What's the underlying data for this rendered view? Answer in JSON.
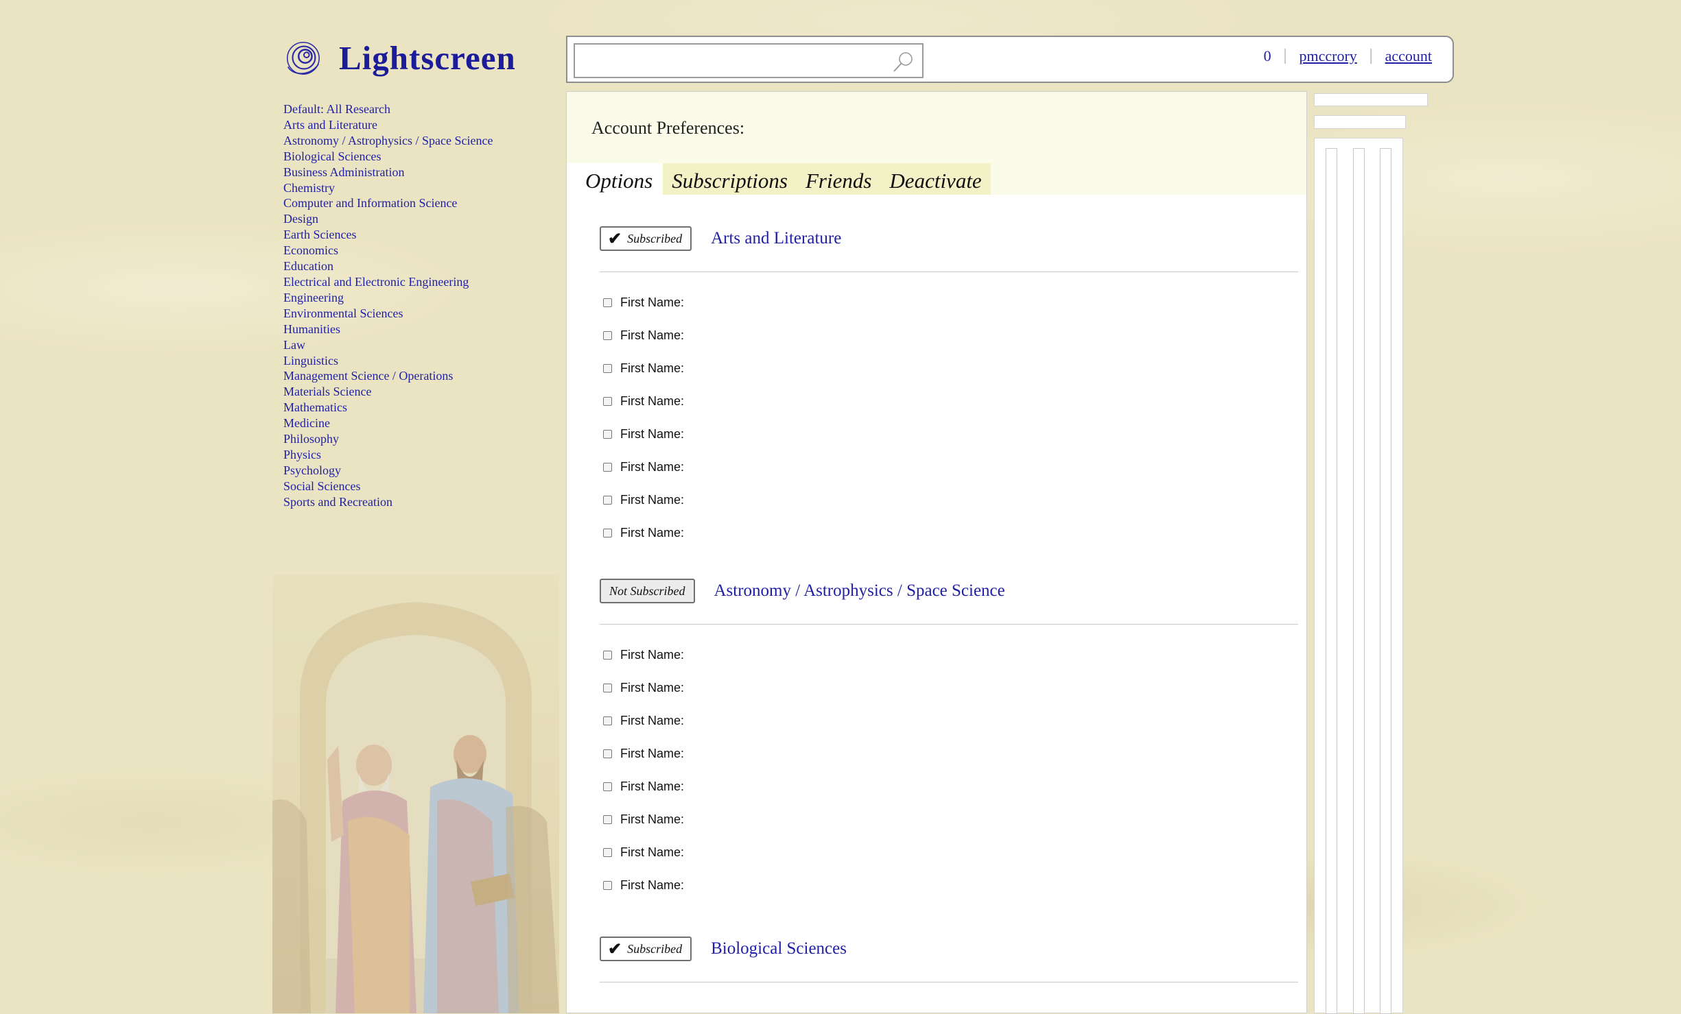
{
  "app": {
    "name": "Lightscreen"
  },
  "search": {
    "placeholder": ""
  },
  "header": {
    "count": "0",
    "username": "pmccrory",
    "account_label": "account",
    "separator": "|"
  },
  "sidebar": {
    "items": [
      "Default: All Research",
      "Arts and Literature",
      "Astronomy / Astrophysics / Space Science",
      "Biological Sciences",
      "Business Administration",
      "Chemistry",
      "Computer and Information Science",
      "Design",
      "Earth Sciences",
      "Economics",
      "Education",
      "Electrical and Electronic Engineering",
      "Engineering",
      "Environmental Sciences",
      "Humanities",
      "Law",
      "Linguistics",
      "Management Science / Operations",
      "Materials Science",
      "Mathematics",
      "Medicine",
      "Philosophy",
      "Physics",
      "Psychology",
      "Social Sciences",
      "Sports and Recreation"
    ]
  },
  "main": {
    "title": "Account Preferences:",
    "tabs": [
      "Options",
      "Subscriptions",
      "Friends",
      "Deactivate"
    ],
    "sections": [
      {
        "status": "Subscribed",
        "name": "Arts and Literature",
        "options": [
          "First Name:",
          "First Name:",
          "First Name:",
          "First Name:",
          "First Name:",
          "First Name:",
          "First Name:",
          "First Name:"
        ]
      },
      {
        "status": "Not Subscribed",
        "name": "Astronomy / Astrophysics / Space Science",
        "options": [
          "First Name:",
          "First Name:",
          "First Name:",
          "First Name:",
          "First Name:",
          "First Name:",
          "First Name:",
          "First Name:"
        ]
      },
      {
        "status": "Subscribed",
        "name": "Biological Sciences",
        "options": []
      }
    ]
  },
  "colors": {
    "background": "#ebe4c2",
    "link": "#1f1fa6",
    "logo": "#1c1c9a",
    "header_tint": "#fbfbea",
    "tab_strip": "#f3f1c6"
  },
  "icons": [
    "logo-spiral-icon",
    "search-icon",
    "checkmark-icon",
    "checkbox-icon"
  ]
}
